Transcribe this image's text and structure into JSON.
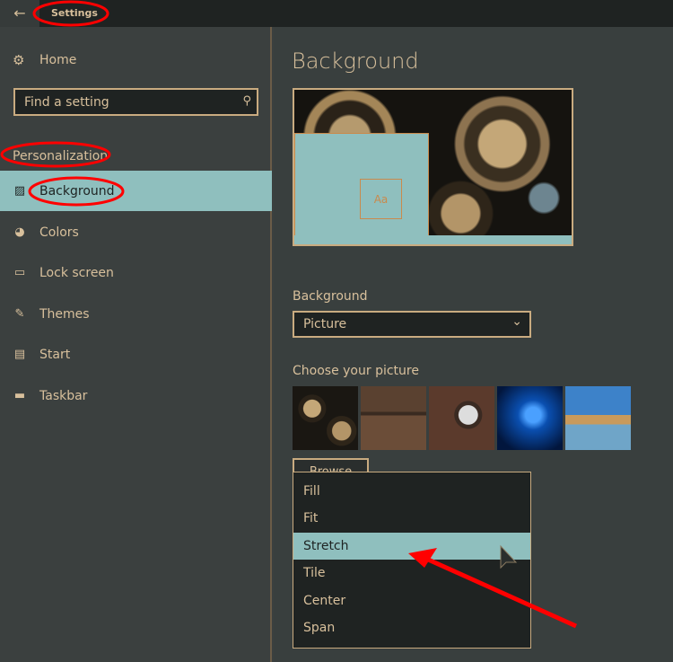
{
  "window": {
    "title": "Settings",
    "back_icon": "arrow-left-icon"
  },
  "sidebar": {
    "home": "Home",
    "search_placeholder": "Find a setting",
    "section": "Personalization",
    "items": [
      {
        "label": "Background",
        "icon": "picture-icon",
        "selected": true
      },
      {
        "label": "Colors",
        "icon": "palette-icon"
      },
      {
        "label": "Lock screen",
        "icon": "lock-screen-icon"
      },
      {
        "label": "Themes",
        "icon": "themes-icon"
      },
      {
        "label": "Start",
        "icon": "start-icon"
      },
      {
        "label": "Taskbar",
        "icon": "taskbar-icon"
      }
    ]
  },
  "main": {
    "title": "Background",
    "preview_sample": "Aa",
    "background_label": "Background",
    "background_value": "Picture",
    "choose_label": "Choose your picture",
    "browse": "Browse",
    "fit_menu": [
      "Fill",
      "Fit",
      "Stretch",
      "Tile",
      "Center",
      "Span"
    ],
    "fit_selected": "Stretch"
  },
  "colors": {
    "accent": "#8fbfbe",
    "text": "#d8c09c",
    "annotation": "#ff0000"
  }
}
